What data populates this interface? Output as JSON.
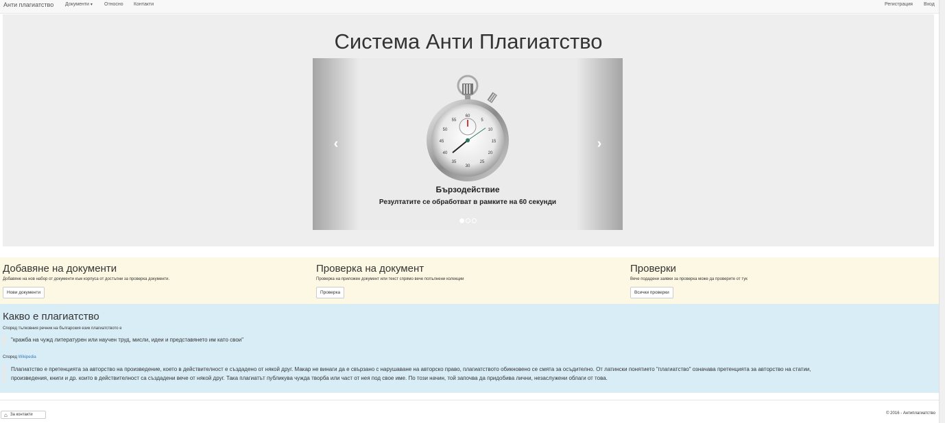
{
  "navbar": {
    "brand": "Анти плагиатство",
    "documents": "Документи",
    "about": "Относно",
    "contacts": "Контакти",
    "register": "Регистрация",
    "login": "Вход"
  },
  "jumbotron": {
    "title": "Система Анти Плагиатство",
    "slide_title": "Бързодействие",
    "slide_text": "Резултатите се обработват в рамките на 60 секунди",
    "prev_icon": "chevron-left-icon",
    "next_icon": "chevron-right-icon",
    "dial_labels": [
      "5",
      "10",
      "15",
      "20",
      "25",
      "30",
      "35",
      "40",
      "45",
      "50",
      "55",
      "60"
    ]
  },
  "features": [
    {
      "title": "Добавяне на документи",
      "text": "Добавяне на нов набор от документи към корпуса от достъпни за проверка документи.",
      "button": "Нови документи"
    },
    {
      "title": "Проверка на документ",
      "text": "Проверка на приложен документ или текст спрямо вече попълнени колекции",
      "button": "Проверка"
    },
    {
      "title": "Проверки",
      "text": "Вече подадени заявки за проверка може да проверите от тук",
      "button": "Всички проверки"
    }
  ],
  "info": {
    "title": "Какво е плагиатство",
    "dictionary_intro": "Според тълковния речник на българския език плагиатството е",
    "dictionary_quote": "\"кражба на чужд литературен или научен труд, мисли, идеи и представянето им като свои\"",
    "wiki_prefix": "Според",
    "wiki_link": "Wikipedia",
    "wiki_quote_line1": "Плагиатство е претенцията за авторство на произведение, което в действителност е създадено от някой друг. Макар не винаги да е свързано с нарушаване на авторско право, плагиатството обикновено се смята за осъдително. От латински понятието \"плагиатство\" означава претенцията за авторство на статии,",
    "wiki_quote_line2": "произведения, книги и др. които в действителност са създадени вече от някой друг. Така плагиатът публикува чужда творба или част от нея под свое име. По този начин, той започва да придобива лични, незаслужени облаги от това."
  },
  "footer": {
    "contacts_button": "За контакти",
    "home_icon": "home-icon",
    "copyright": "© 2016 - Антиплагиатство"
  }
}
